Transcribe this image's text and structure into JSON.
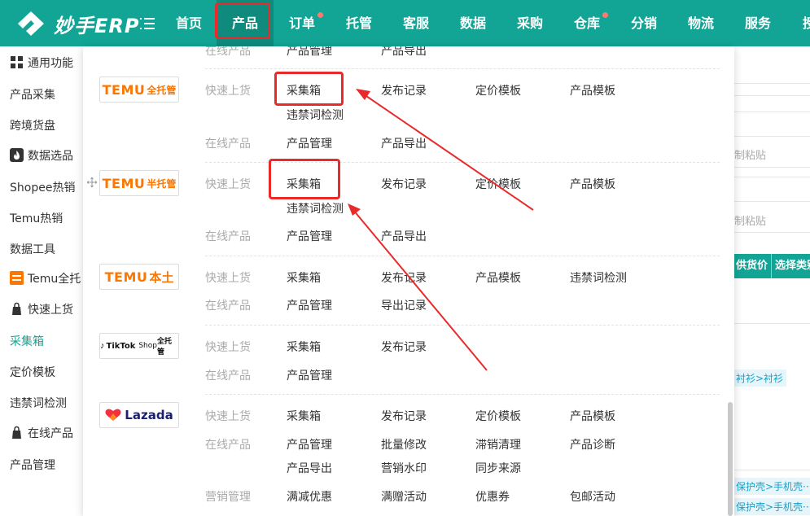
{
  "app": {
    "logo_text": "妙手ERP"
  },
  "nav": {
    "items": [
      "首页",
      "产品",
      "订单",
      "托管",
      "客服",
      "数据",
      "采购",
      "仓库",
      "分销",
      "物流",
      "服务",
      "授"
    ]
  },
  "sidebar": {
    "items": [
      "通用功能",
      "产品采集",
      "跨境货盘",
      "数据选品",
      "Shopee热销",
      "Temu热销",
      "数据工具",
      "Temu全托",
      "快速上货",
      "采集箱",
      "定价模板",
      "违禁词检测",
      "在线产品",
      "产品管理"
    ]
  },
  "background": {
    "texts": [
      "制粘贴",
      "制粘贴"
    ],
    "buttons": [
      "供货价",
      "选择类别"
    ],
    "tags": [
      "衬衫>衬衫",
      "保护壳>手机壳···",
      "保护壳>手机壳···"
    ]
  },
  "dropdown": {
    "platforms": {
      "temu_full": {
        "brand": "TEMU",
        "sub": "全托管"
      },
      "temu_half": {
        "brand": "TEMU",
        "sub": "半托管"
      },
      "temu_local": {
        "brand": "TEMU",
        "sub": "本土"
      },
      "tiktok": {
        "brand": "TikTok",
        "mid": "Shop",
        "sub": "全托管"
      },
      "lazada": {
        "brand": "Lazada"
      }
    },
    "top_partial": {
      "label": "在线产品",
      "c1": "产品管理",
      "c2": "产品导出"
    },
    "temu_full": {
      "quick_label": "快速上货",
      "quick": [
        "采集箱",
        "发布记录",
        "定价模板",
        "产品模板",
        "违禁词检测"
      ],
      "online_label": "在线产品",
      "online": [
        "产品管理",
        "产品导出"
      ]
    },
    "temu_half": {
      "quick_label": "快速上货",
      "quick": [
        "采集箱",
        "发布记录",
        "定价模板",
        "产品模板",
        "违禁词检测"
      ],
      "online_label": "在线产品",
      "online": [
        "产品管理",
        "产品导出"
      ]
    },
    "temu_local": {
      "quick_label": "快速上货",
      "quick": [
        "采集箱",
        "发布记录",
        "产品模板",
        "违禁词检测"
      ],
      "online_label": "在线产品",
      "online": [
        "产品管理",
        "导出记录"
      ]
    },
    "tiktok": {
      "quick_label": "快速上货",
      "quick": [
        "采集箱",
        "发布记录"
      ],
      "online_label": "在线产品",
      "online": [
        "产品管理"
      ]
    },
    "lazada": {
      "quick_label": "快速上货",
      "quick": [
        "采集箱",
        "发布记录",
        "定价模板",
        "产品模板"
      ],
      "online_label": "在线产品",
      "online": [
        "产品管理",
        "批量修改",
        "滞销清理",
        "产品诊断",
        "产品导出",
        "营销水印",
        "同步来源"
      ],
      "marketing_label": "营销管理",
      "marketing": [
        "满减优惠",
        "满赠活动",
        "优惠券",
        "包邮活动"
      ]
    }
  },
  "colors": {
    "brand": "#12a595",
    "brand_dark": "#0e8b7d",
    "highlight_red": "#e82a2a",
    "temu_orange": "#fb7701"
  }
}
